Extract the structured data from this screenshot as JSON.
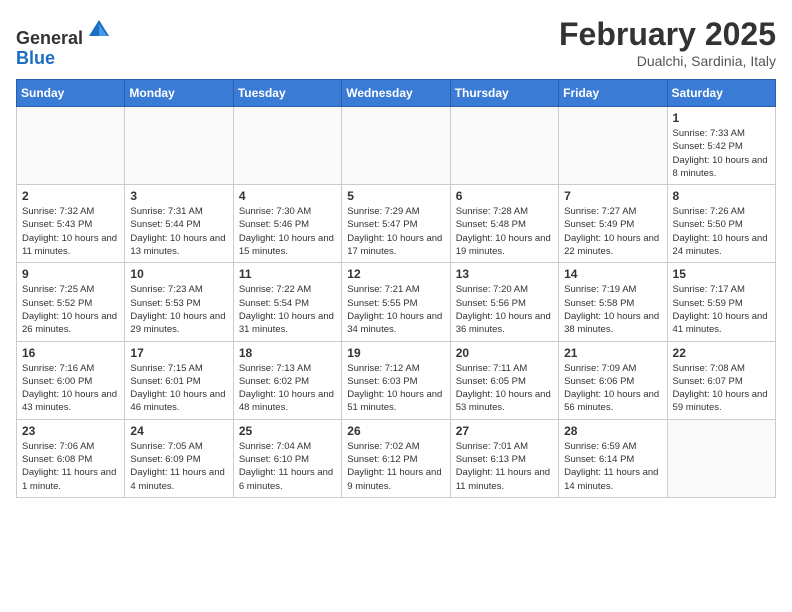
{
  "header": {
    "logo_line1": "General",
    "logo_line2": "Blue",
    "month_year": "February 2025",
    "location": "Dualchi, Sardinia, Italy"
  },
  "weekdays": [
    "Sunday",
    "Monday",
    "Tuesday",
    "Wednesday",
    "Thursday",
    "Friday",
    "Saturday"
  ],
  "weeks": [
    [
      {
        "day": "",
        "info": ""
      },
      {
        "day": "",
        "info": ""
      },
      {
        "day": "",
        "info": ""
      },
      {
        "day": "",
        "info": ""
      },
      {
        "day": "",
        "info": ""
      },
      {
        "day": "",
        "info": ""
      },
      {
        "day": "1",
        "info": "Sunrise: 7:33 AM\nSunset: 5:42 PM\nDaylight: 10 hours and 8 minutes."
      }
    ],
    [
      {
        "day": "2",
        "info": "Sunrise: 7:32 AM\nSunset: 5:43 PM\nDaylight: 10 hours and 11 minutes."
      },
      {
        "day": "3",
        "info": "Sunrise: 7:31 AM\nSunset: 5:44 PM\nDaylight: 10 hours and 13 minutes."
      },
      {
        "day": "4",
        "info": "Sunrise: 7:30 AM\nSunset: 5:46 PM\nDaylight: 10 hours and 15 minutes."
      },
      {
        "day": "5",
        "info": "Sunrise: 7:29 AM\nSunset: 5:47 PM\nDaylight: 10 hours and 17 minutes."
      },
      {
        "day": "6",
        "info": "Sunrise: 7:28 AM\nSunset: 5:48 PM\nDaylight: 10 hours and 19 minutes."
      },
      {
        "day": "7",
        "info": "Sunrise: 7:27 AM\nSunset: 5:49 PM\nDaylight: 10 hours and 22 minutes."
      },
      {
        "day": "8",
        "info": "Sunrise: 7:26 AM\nSunset: 5:50 PM\nDaylight: 10 hours and 24 minutes."
      }
    ],
    [
      {
        "day": "9",
        "info": "Sunrise: 7:25 AM\nSunset: 5:52 PM\nDaylight: 10 hours and 26 minutes."
      },
      {
        "day": "10",
        "info": "Sunrise: 7:23 AM\nSunset: 5:53 PM\nDaylight: 10 hours and 29 minutes."
      },
      {
        "day": "11",
        "info": "Sunrise: 7:22 AM\nSunset: 5:54 PM\nDaylight: 10 hours and 31 minutes."
      },
      {
        "day": "12",
        "info": "Sunrise: 7:21 AM\nSunset: 5:55 PM\nDaylight: 10 hours and 34 minutes."
      },
      {
        "day": "13",
        "info": "Sunrise: 7:20 AM\nSunset: 5:56 PM\nDaylight: 10 hours and 36 minutes."
      },
      {
        "day": "14",
        "info": "Sunrise: 7:19 AM\nSunset: 5:58 PM\nDaylight: 10 hours and 38 minutes."
      },
      {
        "day": "15",
        "info": "Sunrise: 7:17 AM\nSunset: 5:59 PM\nDaylight: 10 hours and 41 minutes."
      }
    ],
    [
      {
        "day": "16",
        "info": "Sunrise: 7:16 AM\nSunset: 6:00 PM\nDaylight: 10 hours and 43 minutes."
      },
      {
        "day": "17",
        "info": "Sunrise: 7:15 AM\nSunset: 6:01 PM\nDaylight: 10 hours and 46 minutes."
      },
      {
        "day": "18",
        "info": "Sunrise: 7:13 AM\nSunset: 6:02 PM\nDaylight: 10 hours and 48 minutes."
      },
      {
        "day": "19",
        "info": "Sunrise: 7:12 AM\nSunset: 6:03 PM\nDaylight: 10 hours and 51 minutes."
      },
      {
        "day": "20",
        "info": "Sunrise: 7:11 AM\nSunset: 6:05 PM\nDaylight: 10 hours and 53 minutes."
      },
      {
        "day": "21",
        "info": "Sunrise: 7:09 AM\nSunset: 6:06 PM\nDaylight: 10 hours and 56 minutes."
      },
      {
        "day": "22",
        "info": "Sunrise: 7:08 AM\nSunset: 6:07 PM\nDaylight: 10 hours and 59 minutes."
      }
    ],
    [
      {
        "day": "23",
        "info": "Sunrise: 7:06 AM\nSunset: 6:08 PM\nDaylight: 11 hours and 1 minute."
      },
      {
        "day": "24",
        "info": "Sunrise: 7:05 AM\nSunset: 6:09 PM\nDaylight: 11 hours and 4 minutes."
      },
      {
        "day": "25",
        "info": "Sunrise: 7:04 AM\nSunset: 6:10 PM\nDaylight: 11 hours and 6 minutes."
      },
      {
        "day": "26",
        "info": "Sunrise: 7:02 AM\nSunset: 6:12 PM\nDaylight: 11 hours and 9 minutes."
      },
      {
        "day": "27",
        "info": "Sunrise: 7:01 AM\nSunset: 6:13 PM\nDaylight: 11 hours and 11 minutes."
      },
      {
        "day": "28",
        "info": "Sunrise: 6:59 AM\nSunset: 6:14 PM\nDaylight: 11 hours and 14 minutes."
      },
      {
        "day": "",
        "info": ""
      }
    ]
  ]
}
